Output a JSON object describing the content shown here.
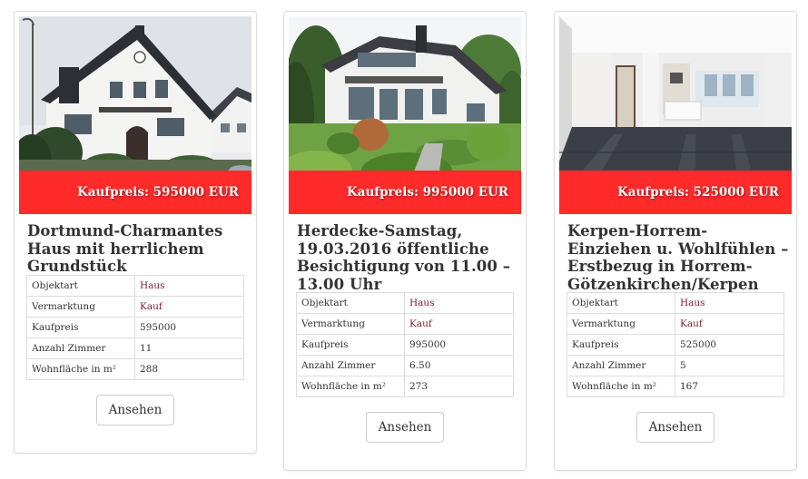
{
  "listings": [
    {
      "price_label": "Kaufpreis: 595000 EUR",
      "title": "Dortmund-Charmantes Haus mit herrlichem Grundstück",
      "facts": [
        {
          "label": "Objektart",
          "value": "Haus"
        },
        {
          "label": "Vermarktung",
          "value": "Kauf"
        },
        {
          "label": "Kaufpreis",
          "value": "595000"
        },
        {
          "label": "Anzahl Zimmer",
          "value": "11"
        },
        {
          "label": "Wohnfläche in m²",
          "value": "288"
        }
      ],
      "button_label": "Ansehen",
      "photo_icon": "white-house-photo"
    },
    {
      "price_label": "Kaufpreis: 995000 EUR",
      "title": "Herdecke-Samstag, 19.03.2016 öffentliche Besichtigung von 11.00 – 13.00 Uhr",
      "facts": [
        {
          "label": "Objektart",
          "value": "Haus"
        },
        {
          "label": "Vermarktung",
          "value": "Kauf"
        },
        {
          "label": "Kaufpreis",
          "value": "995000"
        },
        {
          "label": "Anzahl Zimmer",
          "value": "6.50"
        },
        {
          "label": "Wohnfläche in m²",
          "value": "273"
        }
      ],
      "button_label": "Ansehen",
      "photo_icon": "villa-garden-photo"
    },
    {
      "price_label": "Kaufpreis: 525000 EUR",
      "title": "Kerpen-Horrem-Einziehen u. Wohlfühlen – Erstbezug in Horrem-Götzenkirchen/Kerpen",
      "facts": [
        {
          "label": "Objektart",
          "value": "Haus"
        },
        {
          "label": "Vermarktung",
          "value": "Kauf"
        },
        {
          "label": "Kaufpreis",
          "value": "525000"
        },
        {
          "label": "Anzahl Zimmer",
          "value": "5"
        },
        {
          "label": "Wohnfläche in m²",
          "value": "167"
        }
      ],
      "button_label": "Ansehen",
      "photo_icon": "empty-interior-photo"
    }
  ],
  "colors": {
    "price_band": "#ff2a2a",
    "link_value": "#7a1b2e",
    "border": "#dddddd"
  }
}
